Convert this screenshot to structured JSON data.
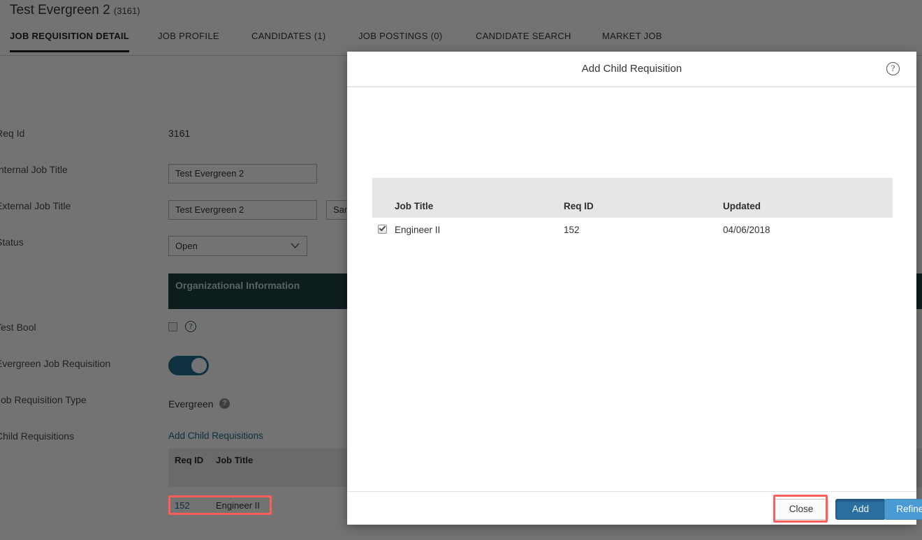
{
  "page": {
    "title": "Test Evergreen 2",
    "req_number": "(3161)"
  },
  "tabs": [
    {
      "label": "JOB REQUISITION DETAIL",
      "active": true
    },
    {
      "label": "JOB PROFILE",
      "active": false
    },
    {
      "label": "CANDIDATES (1)",
      "active": false
    },
    {
      "label": "JOB POSTINGS (0)",
      "active": false
    },
    {
      "label": "CANDIDATE SEARCH",
      "active": false
    },
    {
      "label": "MARKET JOB",
      "active": false
    }
  ],
  "form": {
    "req_id_label": "Req Id",
    "req_id_value": "3161",
    "internal_job_title_label": "Internal Job Title",
    "internal_job_title_value": "Test Evergreen 2",
    "external_job_title_label": "External Job Title",
    "external_job_title_value": "Test Evergreen 2",
    "external_secondary_value": "San",
    "status_label": "Status",
    "status_value": "Open",
    "section_band_label": "Organizational Information",
    "test_bool_label": "Test Bool",
    "test_bool_help": "?",
    "evergreen_toggle_label": "Evergreen Job Requisition",
    "job_requisition_type_label": "Job Requisition Type",
    "job_requisition_type_value": "Evergreen",
    "job_requisition_type_help": "?",
    "child_requisitions_label": "Child Requisitions",
    "add_child_requisitions_link": "Add Child Requisitions",
    "child_table": {
      "columns": [
        "Req ID",
        "Job Title"
      ],
      "rows": [
        {
          "req_id": "152",
          "job_title": "Engineer II"
        }
      ]
    }
  },
  "modal": {
    "title": "Add Child Requisition",
    "help_icon_label": "?",
    "table": {
      "columns": [
        "Job Title",
        "Req ID",
        "Updated"
      ],
      "rows": [
        {
          "checked": true,
          "job_title": "Engineer II",
          "req_id": "152",
          "updated": "04/06/2018"
        }
      ]
    },
    "buttons": {
      "close": "Close",
      "add": "Add",
      "refine_search": "Refine Search"
    }
  },
  "colors": {
    "accent_teal": "#1d4044",
    "toggle_on": "#1d6e8c",
    "link": "#1c6a86",
    "primary_button": "#4a9ad4",
    "pressed_button": "#2b6ea0",
    "annotation": "#fb5f5a",
    "overlay": "rgba(0,0,0,0.55)"
  }
}
